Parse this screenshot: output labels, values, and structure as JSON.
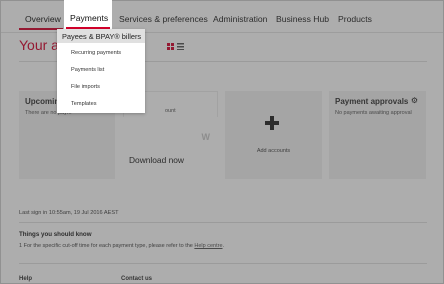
{
  "nav": {
    "items": [
      {
        "label": "Overview"
      },
      {
        "label": "Payments"
      },
      {
        "label": "Services & preferences"
      },
      {
        "label": "Administration"
      },
      {
        "label": "Business Hub"
      },
      {
        "label": "Products"
      }
    ]
  },
  "page": {
    "title": "Your ac"
  },
  "cards": {
    "upcoming": {
      "title": "Upcoming pa",
      "text": "There are no paym"
    },
    "download": {
      "text": "ount",
      "title": "Download now"
    },
    "add": {
      "label": "Add accounts"
    },
    "approvals": {
      "title": "Payment approvals",
      "text": "No payments awaiting approval"
    }
  },
  "signin": "Last sign in 10:55am, 19 Jul 2016 AEST",
  "things": {
    "title": "Things you should know",
    "note_prefix": "1 For the specific cut-off time for each payment type, please refer to the ",
    "note_link": "Help centre",
    "note_suffix": "."
  },
  "footer": {
    "help": "Help",
    "contact": "Contact us"
  },
  "dropdown": {
    "items": [
      {
        "label": "Payees & BPAY® billers"
      },
      {
        "label": "Recurring payments"
      },
      {
        "label": "Payments list"
      },
      {
        "label": "File imports"
      },
      {
        "label": "Templates"
      }
    ]
  },
  "colors": {
    "accent": "#d5002b"
  }
}
